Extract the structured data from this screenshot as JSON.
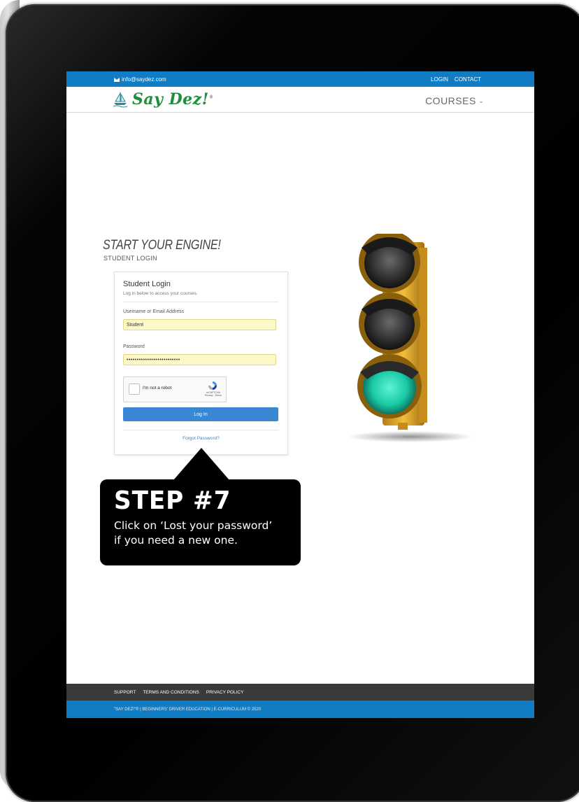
{
  "topbar": {
    "email": "info@saydez.com",
    "login": "LOGIN",
    "contact": "CONTACT"
  },
  "header": {
    "brand": "Say Dez!",
    "brand_mark": "®",
    "menu_courses": "COURSES"
  },
  "page": {
    "heading": "START YOUR ENGINE!",
    "subheading": "STUDENT LOGIN"
  },
  "login_card": {
    "title": "Student Login",
    "subtitle": "Log in below to access your courses.",
    "username_label": "Username or Email Address",
    "username_value": "Student",
    "password_label": "Password",
    "password_value": "••••••••••••••••••••••••••",
    "captcha_label": "I'm not a robot",
    "captcha_brand": "reCAPTCHA",
    "captcha_links": "Privacy - Terms",
    "login_button": "Log In",
    "forgot_link": "Forgot Password?"
  },
  "footer": {
    "links": [
      "SUPPORT",
      "TERMS AND CONDITIONS",
      "PRIVACY POLICY"
    ],
    "copyright": "\"SAY DEZ!\"® | BEGINNERS' DRIVER EDUCATION | E-CURRICULUM © 2020"
  },
  "callout": {
    "title": "STEP #7",
    "text_line1": "Click on ‘Lost your password’",
    "text_line2": "if you need a new one."
  },
  "colors": {
    "topbar_blue": "#0f7cc4",
    "brand_green": "#1e8f3a",
    "button_blue": "#3a88d4",
    "autofill_yellow": "#fcf8c8",
    "footer_dark": "#3a3a3a",
    "signal_green": "#19d7b2",
    "signal_housing": "#e0a62a"
  },
  "icons": [
    "mail-icon",
    "sailboat-logo-icon",
    "chevron-down-icon",
    "recaptcha-icon",
    "traffic-light-image"
  ]
}
